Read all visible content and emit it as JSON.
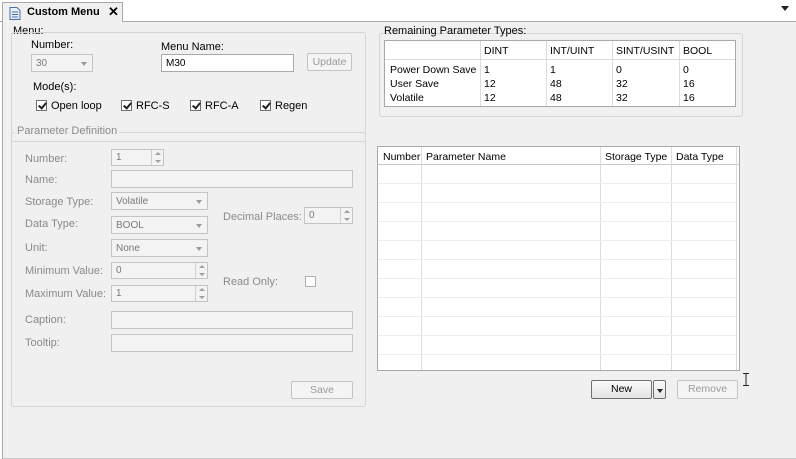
{
  "tab": {
    "title": "Custom Menu"
  },
  "menu_group": {
    "label": "Menu:",
    "number_label": "Number:",
    "number_value": "30",
    "name_label": "Menu Name:",
    "name_value": "M30",
    "update_button": "Update",
    "modes_label": "Mode(s):",
    "modes": [
      {
        "label": "Open loop",
        "checked": true
      },
      {
        "label": "RFC-S",
        "checked": true
      },
      {
        "label": "RFC-A",
        "checked": true
      },
      {
        "label": "Regen",
        "checked": true
      }
    ]
  },
  "param_def": {
    "label": "Parameter Definition",
    "number_label": "Number:",
    "number_value": "1",
    "name_label": "Name:",
    "name_value": "",
    "storage_label": "Storage Type:",
    "storage_value": "Volatile",
    "data_type_label": "Data Type:",
    "data_type_value": "BOOL",
    "decimal_label": "Decimal Places:",
    "decimal_value": "0",
    "unit_label": "Unit:",
    "unit_value": "None",
    "min_label": "Minimum Value:",
    "min_value": "0",
    "max_label": "Maximum Value:",
    "max_value": "1",
    "readonly_label": "Read Only:",
    "caption_label": "Caption:",
    "caption_value": "",
    "tooltip_label": "Tooltip:",
    "tooltip_value": "",
    "save_button": "Save"
  },
  "remaining": {
    "label": "Remaining Parameter Types:",
    "columns": [
      "",
      "DINT",
      "INT/UINT",
      "SINT/USINT",
      "BOOL"
    ],
    "rows": [
      {
        "name": "Power Down Save",
        "values": [
          "1",
          "1",
          "0",
          "0"
        ]
      },
      {
        "name": "User Save",
        "values": [
          "12",
          "48",
          "32",
          "16"
        ]
      },
      {
        "name": "Volatile",
        "values": [
          "12",
          "48",
          "32",
          "16"
        ]
      }
    ]
  },
  "param_list": {
    "columns": [
      "Number",
      "Parameter Name",
      "Storage Type",
      "Data Type"
    ]
  },
  "actions": {
    "new_button": "New",
    "remove_button": "Remove"
  }
}
